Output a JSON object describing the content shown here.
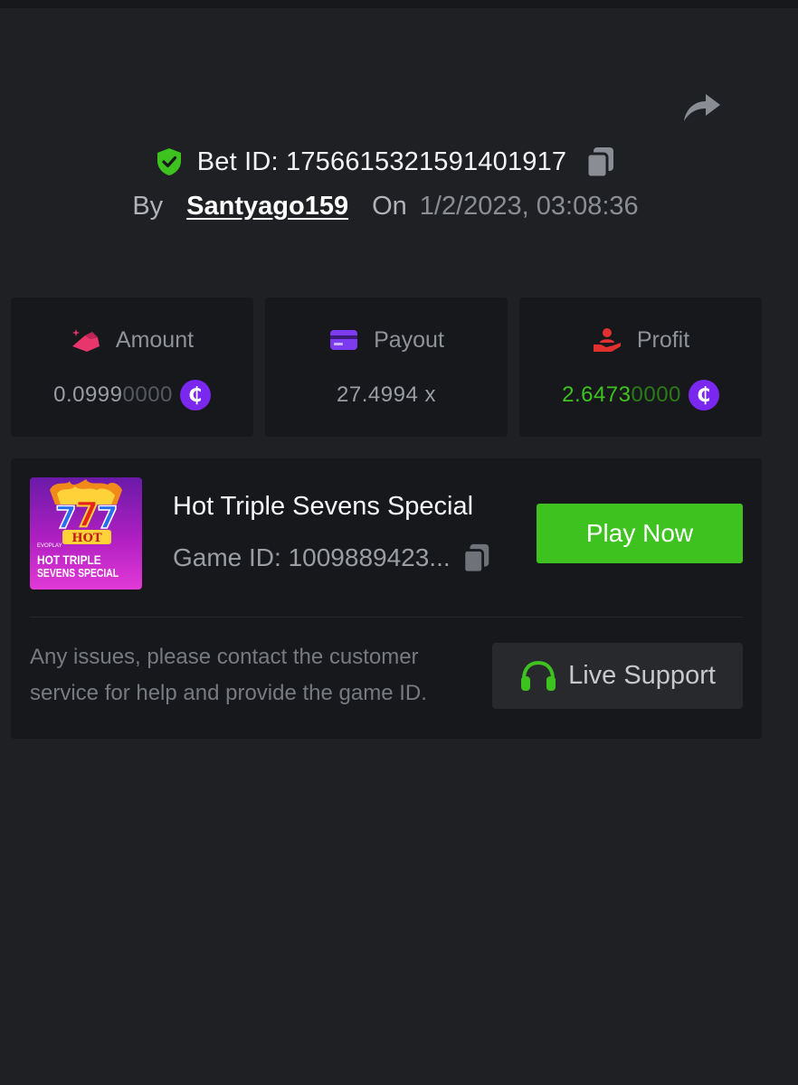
{
  "header": {
    "bet_id_label": "Bet ID: 1756615321591401917",
    "by_label": "By",
    "username": "Santyago159",
    "on_label": "On",
    "timestamp": "1/2/2023, 03:08:36"
  },
  "stats": {
    "amount": {
      "label": "Amount",
      "value_main": "0.0999",
      "value_dim": "0000",
      "currency_symbol": "₵",
      "icon": "amount-icon"
    },
    "payout": {
      "label": "Payout",
      "value": "27.4994 x",
      "icon": "card-icon"
    },
    "profit": {
      "label": "Profit",
      "value_main": "2.6473",
      "value_dim": "0000",
      "currency_symbol": "₵",
      "icon": "hand-user-icon"
    }
  },
  "game": {
    "name": "Hot Triple Sevens Special",
    "game_id": "Game ID: 1009889423...",
    "thumbnail_brand": "EVOPLAY",
    "thumbnail_hot": "HOT",
    "thumbnail_line1": "HOT TRIPLE",
    "thumbnail_line2": "SEVENS SPECIAL",
    "play_label": "Play Now"
  },
  "support": {
    "help_text": "Any issues, please contact the customer service for help and provide the game ID.",
    "button_label": "Live Support",
    "icon": "headset-icon"
  },
  "colors": {
    "background": "#1f2023",
    "card": "#17181b",
    "accent_green": "#3ec21f",
    "coin_purple": "#7a28f0",
    "amount_pink": "#e8356b",
    "payout_purple": "#7b3cf0",
    "profit_red": "#e0302f"
  }
}
